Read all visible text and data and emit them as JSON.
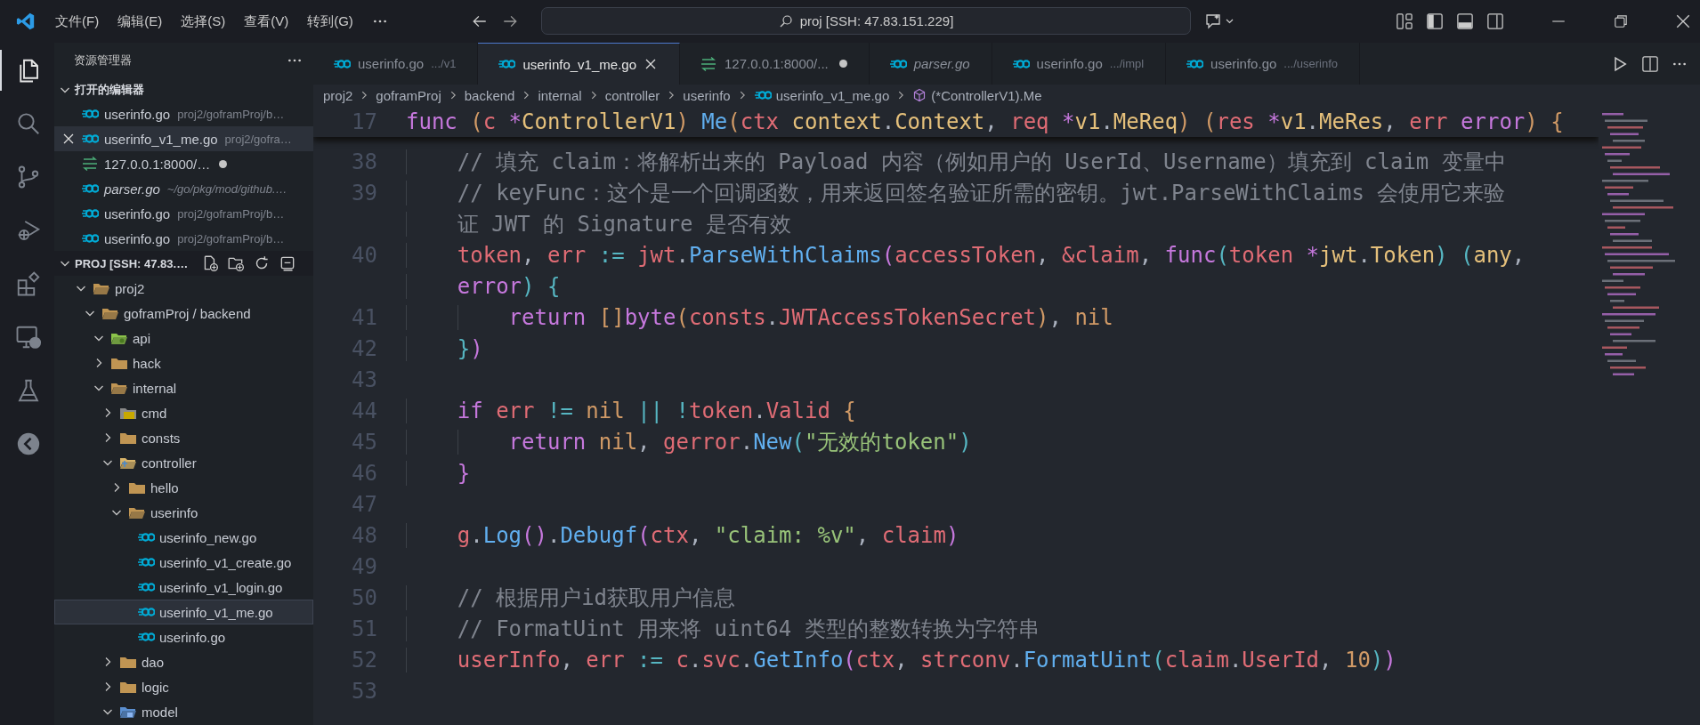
{
  "menu": [
    "文件(F)",
    "编辑(E)",
    "选择(S)",
    "查看(V)",
    "转到(G)"
  ],
  "search": {
    "value": "proj [SSH: 47.83.151.229]"
  },
  "activity_bar": [
    {
      "selected": true
    },
    {
      "selected": false
    },
    {
      "selected": false
    },
    {
      "selected": false
    },
    {
      "selected": false
    },
    {
      "selected": false
    },
    {
      "selected": false
    },
    {
      "selected": false
    }
  ],
  "explorer": {
    "title": "资源管理器"
  },
  "open_editors": {
    "title": "打开的编辑器",
    "expanded": true,
    "items": [
      {
        "kind": "go",
        "name": "userinfo.go",
        "path": "proj2/goframProj/b…",
        "italic": false,
        "selected": false,
        "dirty": false
      },
      {
        "kind": "go",
        "name": "userinfo_v1_me.go",
        "path": "proj2/gofra…",
        "italic": false,
        "selected": true,
        "dirty": false
      },
      {
        "kind": "http",
        "name": "127.0.0.1:8000/…",
        "italic": false,
        "selected": false,
        "dirty": true
      },
      {
        "kind": "go",
        "name": "parser.go",
        "path": "~/go/pkg/mod/github.…",
        "italic": true,
        "selected": false,
        "dirty": false
      },
      {
        "kind": "go",
        "name": "userinfo.go",
        "path": "proj2/goframProj/b…",
        "italic": false,
        "selected": false,
        "dirty": false
      },
      {
        "kind": "go",
        "name": "userinfo.go",
        "path": "proj2/goframProj/b…",
        "italic": false,
        "selected": false,
        "dirty": false
      }
    ]
  },
  "project": {
    "title": "PROJ [SSH: 47.83.…",
    "expanded": true,
    "tree": [
      {
        "kind": "folder",
        "name": "proj2",
        "expanded": true,
        "selected": false,
        "children": [
          {
            "kind": "folder",
            "name": "goframProj / backend",
            "expanded": true,
            "selected": false,
            "children": [
              {
                "kind": "api",
                "name": "api",
                "expanded": true,
                "selected": false
              },
              {
                "kind": "folder",
                "name": "hack",
                "expanded": false,
                "selected": false
              },
              {
                "kind": "folder",
                "name": "internal",
                "expanded": true,
                "selected": false,
                "children": [
                  {
                    "kind": "cmd",
                    "name": "cmd",
                    "expanded": false,
                    "selected": false
                  },
                  {
                    "kind": "folder",
                    "name": "consts",
                    "expanded": false,
                    "selected": false
                  },
                  {
                    "kind": "controller",
                    "name": "controller",
                    "expanded": true,
                    "selected": false,
                    "children": [
                      {
                        "kind": "folder",
                        "name": "hello",
                        "expanded": false,
                        "selected": false
                      },
                      {
                        "kind": "folder",
                        "name": "userinfo",
                        "expanded": true,
                        "selected": false,
                        "children": [
                          {
                            "kind": "go",
                            "name": "userinfo_new.go",
                            "selected": false
                          },
                          {
                            "kind": "go",
                            "name": "userinfo_v1_create.go",
                            "selected": false
                          },
                          {
                            "kind": "go",
                            "name": "userinfo_v1_login.go",
                            "selected": false
                          },
                          {
                            "kind": "go",
                            "name": "userinfo_v1_me.go",
                            "selected": true
                          },
                          {
                            "kind": "go",
                            "name": "userinfo.go",
                            "selected": false
                          }
                        ]
                      }
                    ]
                  },
                  {
                    "kind": "folder",
                    "name": "dao",
                    "expanded": false,
                    "selected": false
                  },
                  {
                    "kind": "folder",
                    "name": "logic",
                    "expanded": false,
                    "selected": false
                  },
                  {
                    "kind": "model",
                    "name": "model",
                    "expanded": true,
                    "selected": false
                  }
                ]
              }
            ]
          }
        ]
      }
    ]
  },
  "tabs": [
    {
      "kind": "go",
      "name": "userinfo.go",
      "description": ".../v1",
      "italic": false,
      "selected": false,
      "dirty": false
    },
    {
      "kind": "go",
      "name": "userinfo_v1_me.go",
      "italic": false,
      "selected": true,
      "dirty": false
    },
    {
      "kind": "http",
      "name": "127.0.0.1:8000/...",
      "italic": false,
      "selected": false,
      "dirty": true
    },
    {
      "kind": "go",
      "name": "parser.go",
      "italic": true,
      "selected": false,
      "dirty": false
    },
    {
      "kind": "go",
      "name": "userinfo.go",
      "description": ".../impl",
      "italic": false,
      "selected": false,
      "dirty": false
    },
    {
      "kind": "go",
      "name": "userinfo.go",
      "description": ".../userinfo",
      "italic": false,
      "selected": false,
      "dirty": false
    }
  ],
  "breadcrumb": [
    {
      "kind": "folder",
      "text": "proj2"
    },
    {
      "kind": "folder",
      "text": "goframProj"
    },
    {
      "kind": "folder",
      "text": "backend"
    },
    {
      "kind": "folder",
      "text": "internal"
    },
    {
      "kind": "folder",
      "text": "controller"
    },
    {
      "kind": "folder",
      "text": "userinfo"
    },
    {
      "kind": "go",
      "text": "userinfo_v1_me.go"
    },
    {
      "kind": "method",
      "text": "(*ControllerV1).Me"
    }
  ],
  "editor": {
    "sticky": {
      "number": "17",
      "rows": [
        [
          {
            "kind": "kw",
            "text": "func"
          },
          {
            "kind": "pun",
            "text": " "
          },
          {
            "kind": "b1",
            "text": "("
          },
          {
            "kind": "var",
            "text": "c"
          },
          {
            "kind": "pun",
            "text": " "
          },
          {
            "kind": "kw",
            "text": "*"
          },
          {
            "kind": "type",
            "text": "ControllerV1"
          },
          {
            "kind": "b1",
            "text": ")"
          },
          {
            "kind": "pun",
            "text": " "
          },
          {
            "kind": "fn",
            "text": "Me"
          },
          {
            "kind": "b1",
            "text": "("
          },
          {
            "kind": "var",
            "text": "ctx"
          },
          {
            "kind": "pun",
            "text": " "
          },
          {
            "kind": "type",
            "text": "context"
          },
          {
            "kind": "pun",
            "text": "."
          },
          {
            "kind": "type",
            "text": "Context"
          },
          {
            "kind": "pun",
            "text": ", "
          },
          {
            "kind": "var",
            "text": "req"
          },
          {
            "kind": "pun",
            "text": " "
          },
          {
            "kind": "kw",
            "text": "*"
          },
          {
            "kind": "type",
            "text": "v1"
          },
          {
            "kind": "pun",
            "text": "."
          },
          {
            "kind": "type",
            "text": "MeReq"
          },
          {
            "kind": "b1",
            "text": ")"
          },
          {
            "kind": "pun",
            "text": " "
          },
          {
            "kind": "b1",
            "text": "("
          },
          {
            "kind": "var",
            "text": "res"
          },
          {
            "kind": "pun",
            "text": " "
          },
          {
            "kind": "kw",
            "text": "*"
          },
          {
            "kind": "type",
            "text": "v1"
          },
          {
            "kind": "pun",
            "text": "."
          },
          {
            "kind": "type",
            "text": "MeRes"
          },
          {
            "kind": "pun",
            "text": ", "
          },
          {
            "kind": "var",
            "text": "err"
          },
          {
            "kind": "pun",
            "text": " "
          },
          {
            "kind": "kw",
            "text": "error"
          },
          {
            "kind": "b1",
            "text": ")"
          },
          {
            "kind": "pun",
            "text": " "
          },
          {
            "kind": "b1",
            "text": "{"
          }
        ]
      ]
    },
    "lines": [
      {
        "number": "38",
        "rows": [
          [
            {
              "kind": "ws",
              "text": "    "
            },
            {
              "kind": "cmt",
              "text": "// 填充 claim：将解析出来的 Payload 内容（例如用户的 UserId、Username）填充到 claim 变量中"
            }
          ]
        ]
      },
      {
        "number": "39",
        "rows": [
          [
            {
              "kind": "ws",
              "text": "    "
            },
            {
              "kind": "cmt",
              "text": "// keyFunc：这个是一个回调函数，用来返回签名验证所需的密钥。jwt.ParseWithClaims 会使用它来验"
            }
          ],
          [
            {
              "kind": "ws",
              "text": "    "
            },
            {
              "kind": "cmt",
              "text": "证 JWT 的 Signature 是否有效"
            }
          ]
        ]
      },
      {
        "number": "40",
        "rows": [
          [
            {
              "kind": "ws",
              "text": "    "
            },
            {
              "kind": "var",
              "text": "token"
            },
            {
              "kind": "pun",
              "text": ", "
            },
            {
              "kind": "var",
              "text": "err"
            },
            {
              "kind": "pun",
              "text": " "
            },
            {
              "kind": "op",
              "text": ":="
            },
            {
              "kind": "pun",
              "text": " "
            },
            {
              "kind": "var",
              "text": "jwt"
            },
            {
              "kind": "pun",
              "text": "."
            },
            {
              "kind": "fn",
              "text": "ParseWithClaims"
            },
            {
              "kind": "b2",
              "text": "("
            },
            {
              "kind": "var",
              "text": "accessToken"
            },
            {
              "kind": "pun",
              "text": ", "
            },
            {
              "kind": "var",
              "text": "&claim"
            },
            {
              "kind": "pun",
              "text": ", "
            },
            {
              "kind": "kw",
              "text": "func"
            },
            {
              "kind": "b3",
              "text": "("
            },
            {
              "kind": "var",
              "text": "token"
            },
            {
              "kind": "pun",
              "text": " "
            },
            {
              "kind": "kw",
              "text": "*"
            },
            {
              "kind": "type",
              "text": "jwt"
            },
            {
              "kind": "pun",
              "text": "."
            },
            {
              "kind": "type",
              "text": "Token"
            },
            {
              "kind": "b3",
              "text": ")"
            },
            {
              "kind": "pun",
              "text": " "
            },
            {
              "kind": "b3",
              "text": "("
            },
            {
              "kind": "type",
              "text": "any"
            },
            {
              "kind": "pun",
              "text": ","
            }
          ],
          [
            {
              "kind": "ws",
              "text": "    "
            },
            {
              "kind": "kw",
              "text": "error"
            },
            {
              "kind": "b3",
              "text": ")"
            },
            {
              "kind": "pun",
              "text": " "
            },
            {
              "kind": "b3",
              "text": "{"
            }
          ]
        ]
      },
      {
        "number": "41",
        "rows": [
          [
            {
              "kind": "ws",
              "text": "        "
            },
            {
              "kind": "kw",
              "text": "return"
            },
            {
              "kind": "pun",
              "text": " "
            },
            {
              "kind": "b1",
              "text": "[]"
            },
            {
              "kind": "kw",
              "text": "byte"
            },
            {
              "kind": "b1",
              "text": "("
            },
            {
              "kind": "var",
              "text": "consts"
            },
            {
              "kind": "pun",
              "text": "."
            },
            {
              "kind": "var",
              "text": "JWTAccessTokenSecret"
            },
            {
              "kind": "b1",
              "text": ")"
            },
            {
              "kind": "pun",
              "text": ", "
            },
            {
              "kind": "num",
              "text": "nil"
            }
          ]
        ]
      },
      {
        "number": "42",
        "rows": [
          [
            {
              "kind": "ws",
              "text": "    "
            },
            {
              "kind": "b3",
              "text": "}"
            },
            {
              "kind": "b2",
              "text": ")"
            }
          ]
        ]
      },
      {
        "number": "43",
        "rows": [
          []
        ]
      },
      {
        "number": "44",
        "rows": [
          [
            {
              "kind": "ws",
              "text": "    "
            },
            {
              "kind": "kw",
              "text": "if"
            },
            {
              "kind": "pun",
              "text": " "
            },
            {
              "kind": "var",
              "text": "err"
            },
            {
              "kind": "pun",
              "text": " "
            },
            {
              "kind": "op",
              "text": "!="
            },
            {
              "kind": "pun",
              "text": " "
            },
            {
              "kind": "num",
              "text": "nil"
            },
            {
              "kind": "pun",
              "text": " "
            },
            {
              "kind": "op",
              "text": "||"
            },
            {
              "kind": "pun",
              "text": " "
            },
            {
              "kind": "op",
              "text": "!"
            },
            {
              "kind": "var",
              "text": "token"
            },
            {
              "kind": "pun",
              "text": "."
            },
            {
              "kind": "var",
              "text": "Valid"
            },
            {
              "kind": "pun",
              "text": " "
            },
            {
              "kind": "b1",
              "text": "{"
            }
          ]
        ]
      },
      {
        "number": "45",
        "rows": [
          [
            {
              "kind": "ws",
              "text": "        "
            },
            {
              "kind": "kw",
              "text": "return"
            },
            {
              "kind": "pun",
              "text": " "
            },
            {
              "kind": "num",
              "text": "nil"
            },
            {
              "kind": "pun",
              "text": ", "
            },
            {
              "kind": "var",
              "text": "gerror"
            },
            {
              "kind": "pun",
              "text": "."
            },
            {
              "kind": "fn",
              "text": "New"
            },
            {
              "kind": "b3",
              "text": "("
            },
            {
              "kind": "str",
              "text": "\"无效的token\""
            },
            {
              "kind": "b3",
              "text": ")"
            }
          ]
        ]
      },
      {
        "number": "46",
        "rows": [
          [
            {
              "kind": "ws",
              "text": "    "
            },
            {
              "kind": "b2",
              "text": "}"
            }
          ]
        ]
      },
      {
        "number": "47",
        "rows": [
          []
        ]
      },
      {
        "number": "48",
        "rows": [
          [
            {
              "kind": "ws",
              "text": "    "
            },
            {
              "kind": "var",
              "text": "g"
            },
            {
              "kind": "pun",
              "text": "."
            },
            {
              "kind": "fn",
              "text": "Log"
            },
            {
              "kind": "b2",
              "text": "()"
            },
            {
              "kind": "pun",
              "text": "."
            },
            {
              "kind": "fn",
              "text": "Debugf"
            },
            {
              "kind": "b2",
              "text": "("
            },
            {
              "kind": "var",
              "text": "ctx"
            },
            {
              "kind": "pun",
              "text": ", "
            },
            {
              "kind": "str",
              "text": "\"claim: %v\""
            },
            {
              "kind": "pun",
              "text": ", "
            },
            {
              "kind": "var",
              "text": "claim"
            },
            {
              "kind": "b2",
              "text": ")"
            }
          ]
        ]
      },
      {
        "number": "49",
        "rows": [
          []
        ]
      },
      {
        "number": "50",
        "rows": [
          [
            {
              "kind": "ws",
              "text": "    "
            },
            {
              "kind": "cmt",
              "text": "// 根据用户id获取用户信息"
            }
          ]
        ]
      },
      {
        "number": "51",
        "rows": [
          [
            {
              "kind": "ws",
              "text": "    "
            },
            {
              "kind": "cmt",
              "text": "// FormatUint 用来将 uint64 类型的整数转换为字符串"
            }
          ]
        ]
      },
      {
        "number": "52",
        "rows": [
          [
            {
              "kind": "ws",
              "text": "    "
            },
            {
              "kind": "var",
              "text": "userInfo"
            },
            {
              "kind": "pun",
              "text": ", "
            },
            {
              "kind": "var",
              "text": "err"
            },
            {
              "kind": "pun",
              "text": " "
            },
            {
              "kind": "op",
              "text": ":="
            },
            {
              "kind": "pun",
              "text": " "
            },
            {
              "kind": "var",
              "text": "c"
            },
            {
              "kind": "pun",
              "text": "."
            },
            {
              "kind": "var",
              "text": "svc"
            },
            {
              "kind": "pun",
              "text": "."
            },
            {
              "kind": "fn",
              "text": "GetInfo"
            },
            {
              "kind": "b2",
              "text": "("
            },
            {
              "kind": "var",
              "text": "ctx"
            },
            {
              "kind": "pun",
              "text": ", "
            },
            {
              "kind": "var",
              "text": "strconv"
            },
            {
              "kind": "pun",
              "text": "."
            },
            {
              "kind": "fn",
              "text": "FormatUint"
            },
            {
              "kind": "b3",
              "text": "("
            },
            {
              "kind": "var",
              "text": "claim"
            },
            {
              "kind": "pun",
              "text": "."
            },
            {
              "kind": "var",
              "text": "UserId"
            },
            {
              "kind": "pun",
              "text": ", "
            },
            {
              "kind": "num",
              "text": "10"
            },
            {
              "kind": "b3",
              "text": ")"
            },
            {
              "kind": "b2",
              "text": ")"
            }
          ]
        ]
      },
      {
        "number": "53",
        "rows": [
          []
        ]
      }
    ]
  }
}
